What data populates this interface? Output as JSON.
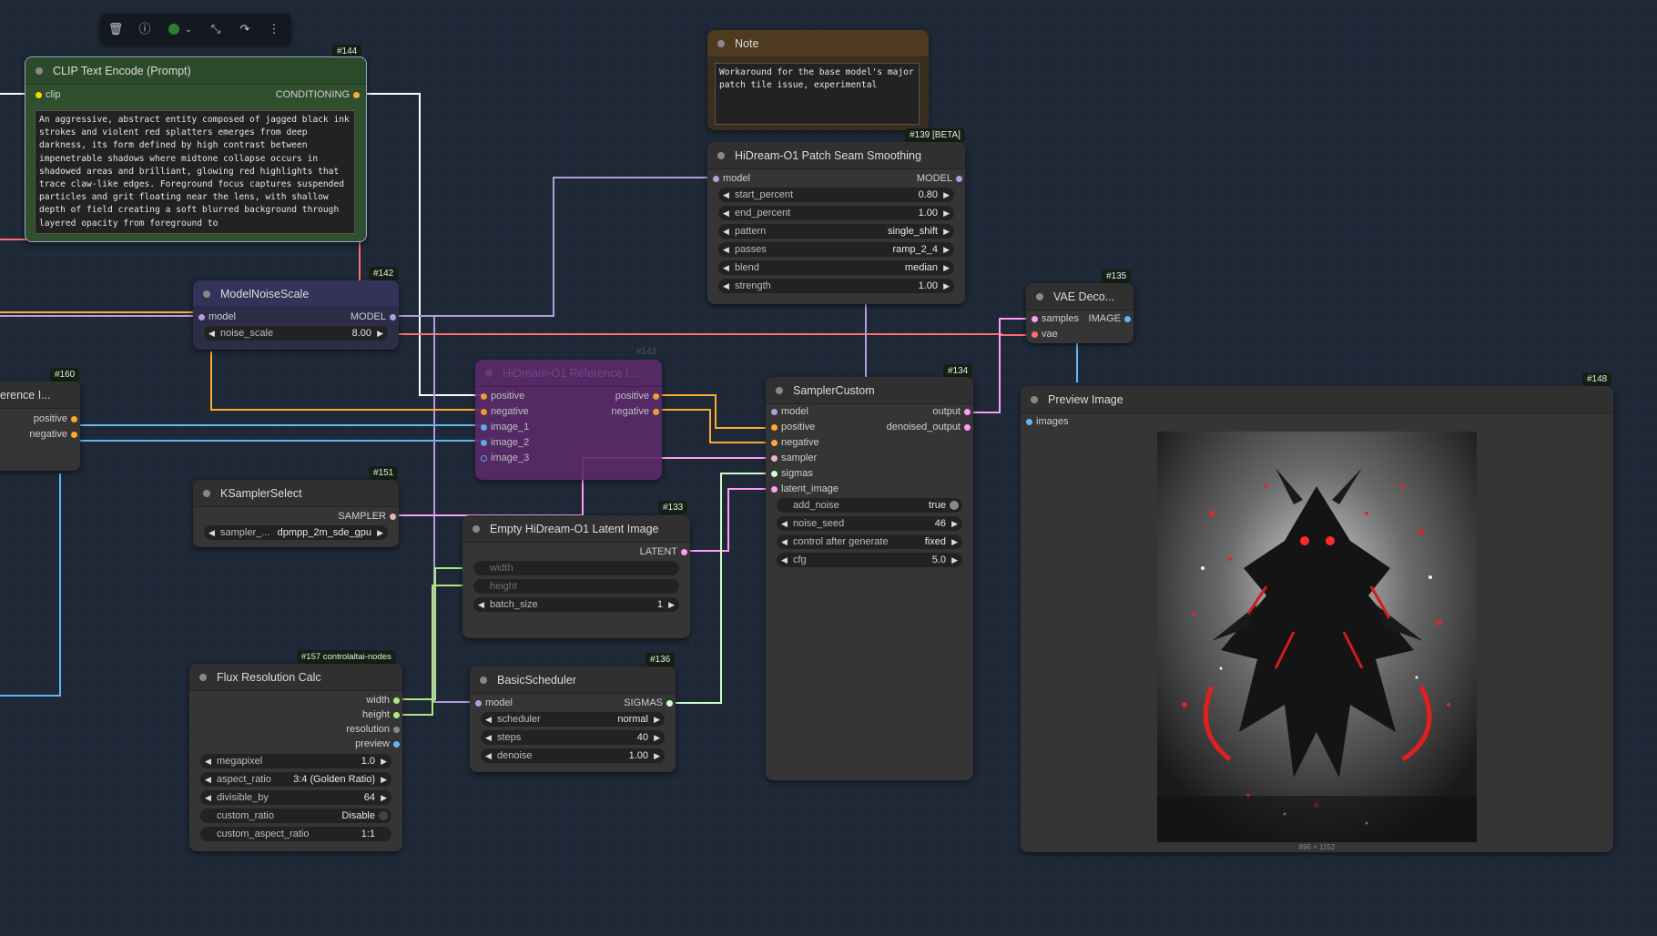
{
  "toolbar": {
    "icons": [
      "trash-icon",
      "info-icon",
      "color-dot-icon",
      "chevron-down-icon",
      "fit-view-icon",
      "redo-icon",
      "more-vertical-icon"
    ]
  },
  "nodes": {
    "clip_text_encode": {
      "id": "#144",
      "title": "CLIP Text Encode (Prompt)",
      "input": "clip",
      "output": "CONDITIONING",
      "text": "An aggressive, abstract entity composed of jagged black ink strokes and violent red splatters emerges from deep darkness, its form defined by high contrast between impenetrable shadows where midtone collapse occurs in shadowed areas and brilliant, glowing red highlights that trace claw-like edges. Foreground focus captures suspended particles and grit floating near the lens, with shallow depth of field creating a soft blurred background through layered opacity from foreground to"
    },
    "note": {
      "title": "Note",
      "text": "Workaround for the base model's major patch tile issue, experimental"
    },
    "patch_seam": {
      "id": "#139 [BETA]",
      "title": "HiDream-O1 Patch Seam Smoothing",
      "input": "model",
      "output": "MODEL",
      "widgets": [
        {
          "label": "start_percent",
          "value": "0.80"
        },
        {
          "label": "end_percent",
          "value": "1.00"
        },
        {
          "label": "pattern",
          "value": "single_shift"
        },
        {
          "label": "passes",
          "value": "ramp_2_4"
        },
        {
          "label": "blend",
          "value": "median"
        },
        {
          "label": "strength",
          "value": "1.00"
        }
      ]
    },
    "model_noise_scale": {
      "id": "#142",
      "title": "ModelNoiseScale",
      "input": "model",
      "output": "MODEL",
      "widget": {
        "label": "noise_scale",
        "value": "8.00"
      }
    },
    "reference_left": {
      "id": "#160",
      "title": "erence I...",
      "outputs": [
        "positive",
        "negative"
      ]
    },
    "hidream_reference": {
      "id": "#143",
      "title": "HiDream-O1 Reference I...",
      "inputs": [
        "positive",
        "negative",
        "image_1",
        "image_2",
        "image_3"
      ],
      "outputs": [
        "positive",
        "negative"
      ]
    },
    "ksampler_select": {
      "id": "#151",
      "title": "KSamplerSelect",
      "output": "SAMPLER",
      "widget": {
        "label": "sampler_...",
        "value": "dpmpp_2m_sde_gpu"
      }
    },
    "empty_latent": {
      "id": "#133",
      "title": "Empty HiDream-O1 Latent Image",
      "output": "LATENT",
      "inputs": [
        "width",
        "height"
      ],
      "widget": {
        "label": "batch_size",
        "value": "1"
      }
    },
    "sampler_custom": {
      "id": "#134",
      "title": "SamplerCustom",
      "inputs": [
        "model",
        "positive",
        "negative",
        "sampler",
        "sigmas",
        "latent_image"
      ],
      "outputs": [
        "output",
        "denoised_output"
      ],
      "widgets": [
        {
          "label": "add_noise",
          "value": "true"
        },
        {
          "label": "noise_seed",
          "value": "46"
        },
        {
          "label": "control after generate",
          "value": "fixed"
        },
        {
          "label": "cfg",
          "value": "5.0"
        }
      ]
    },
    "vae_decode": {
      "id": "#135",
      "title": "VAE Deco...",
      "inputs": [
        "samples",
        "vae"
      ],
      "output": "IMAGE"
    },
    "preview_image": {
      "id": "#148",
      "title": "Preview Image",
      "input": "images",
      "dimensions": "896 × 1152"
    },
    "flux_resolution": {
      "id": "#157 controlaltai-nodes",
      "title": "Flux Resolution Calc",
      "outputs": [
        "width",
        "height",
        "resolution",
        "preview"
      ],
      "widgets": [
        {
          "label": "megapixel",
          "value": "1.0"
        },
        {
          "label": "aspect_ratio",
          "value": "3:4 (Golden Ratio)"
        },
        {
          "label": "divisible_by",
          "value": "64"
        },
        {
          "label": "custom_ratio",
          "value": "Disable"
        },
        {
          "label": "custom_aspect_ratio",
          "value": "1:1"
        }
      ]
    },
    "basic_scheduler": {
      "id": "#136",
      "title": "BasicScheduler",
      "input": "model",
      "output": "SIGMAS",
      "widgets": [
        {
          "label": "scheduler",
          "value": "normal"
        },
        {
          "label": "steps",
          "value": "40"
        },
        {
          "label": "denoise",
          "value": "1.00"
        }
      ]
    }
  },
  "colors": {
    "model": "#b39ddb",
    "conditioning": "#ffa931",
    "clip": "#ffd500",
    "image": "#64b5f6",
    "latent": "#ff9cf9",
    "vae": "#ff6e6e",
    "sigmas": "#cdffcd",
    "sampler": "#ecb4b4",
    "int": "#aeea7a"
  }
}
